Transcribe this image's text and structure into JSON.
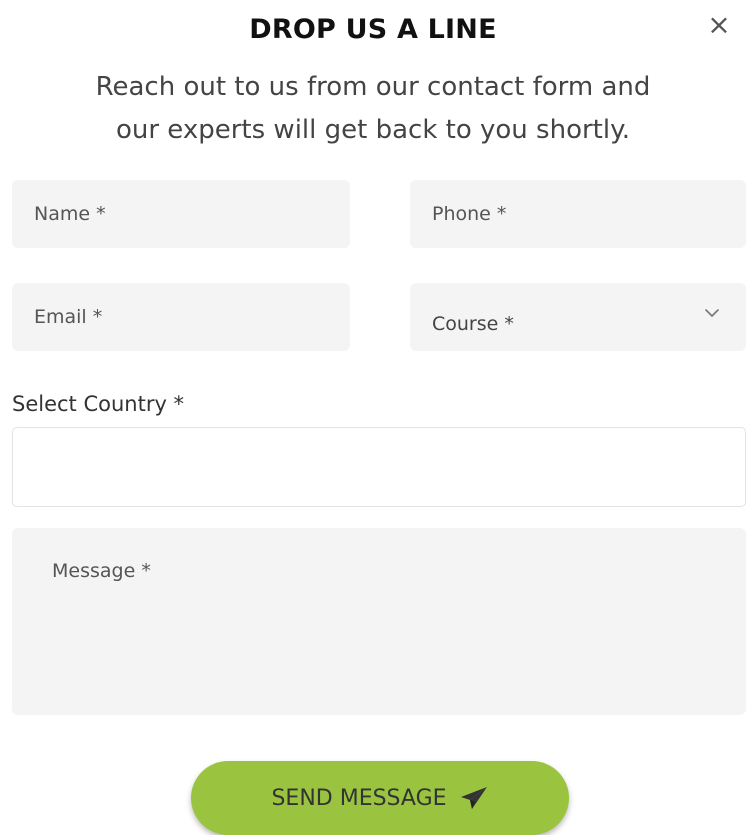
{
  "modal": {
    "close_symbol": "×",
    "title": "DROP US A LINE",
    "subtitle_line1": "Reach out to us from our contact form and",
    "subtitle_line2": "our experts will get back to you shortly."
  },
  "form": {
    "name_placeholder": "Name *",
    "phone_placeholder": "Phone *",
    "email_placeholder": "Email *",
    "course_value": "Course *",
    "country_label": "Select Country *",
    "message_placeholder": "Message *",
    "send_label": "SEND MESSAGE",
    "send_icon": "paper-plane-icon",
    "course_icon": "chevron-down-icon",
    "close_icon": "close-icon"
  },
  "colors": {
    "accent": "#9ac43f",
    "field_bg": "#f4f4f4",
    "title": "#111111",
    "text": "#444444"
  }
}
